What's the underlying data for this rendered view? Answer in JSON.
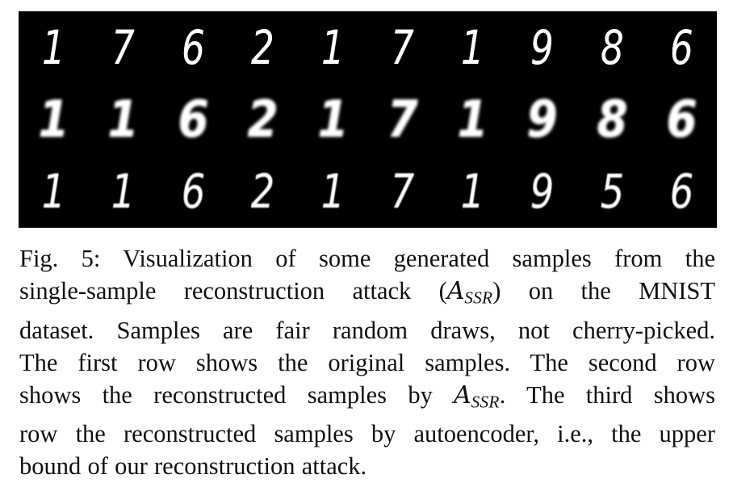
{
  "figure": {
    "label": "Fig. 5:",
    "panel": {
      "background_color": "#000000",
      "digit_color": "#ffffff",
      "columns": 10,
      "rows": 3,
      "row_descriptions": [
        "original samples",
        "reconstructed samples by A_SSR",
        "reconstructed samples by autoencoder"
      ],
      "grid": [
        [
          "1",
          "7",
          "6",
          "2",
          "1",
          "7",
          "1",
          "9",
          "8",
          "6"
        ],
        [
          "1",
          "1",
          "6",
          "2",
          "1",
          "7",
          "1",
          "9",
          "8",
          "6"
        ],
        [
          "1",
          "1",
          "6",
          "2",
          "1",
          "7",
          "1",
          "9",
          "5",
          "6"
        ]
      ]
    },
    "caption": {
      "full_text": "Fig. 5: Visualization of some generated samples from the single-sample reconstruction attack (A_SSR) on the MNIST dataset. Samples are fair random draws, not cherry-picked. The first row shows the original samples. The second row shows the reconstructed samples by A_SSR. The third shows row the reconstructed samples by autoencoder, i.e., the upper bound of our reconstruction attack.",
      "lines": [
        {
          "id": "line1",
          "segments": [
            {
              "type": "text",
              "value": "Fig. 5: Visualization of some generated samples from the"
            }
          ]
        },
        {
          "id": "line2",
          "segments": [
            {
              "type": "text",
              "value": "single-sample reconstruction attack ("
            },
            {
              "type": "mathcal",
              "value": "A"
            },
            {
              "type": "mathsub",
              "value": "SSR"
            },
            {
              "type": "text",
              "value": ") on the MNIST"
            }
          ]
        },
        {
          "id": "line3",
          "segments": [
            {
              "type": "text",
              "value": "dataset. Samples are fair random draws, not cherry-picked."
            }
          ]
        },
        {
          "id": "line4",
          "segments": [
            {
              "type": "text",
              "value": "The first row shows the original samples. The second row"
            }
          ]
        },
        {
          "id": "line5",
          "segments": [
            {
              "type": "text",
              "value": "shows the reconstructed samples by "
            },
            {
              "type": "mathcal",
              "value": "A"
            },
            {
              "type": "mathsub",
              "value": "SSR"
            },
            {
              "type": "text",
              "value": ". The third shows"
            }
          ]
        },
        {
          "id": "line6",
          "segments": [
            {
              "type": "text",
              "value": "row the reconstructed samples by autoencoder, i.e., the upper"
            }
          ]
        },
        {
          "id": "line7",
          "segments": [
            {
              "type": "text",
              "value": "bound of our reconstruction attack."
            }
          ]
        }
      ],
      "line_texts": {
        "line1": "Fig. 5: Visualization of some generated samples from the",
        "line2_prefix": "single-sample reconstruction attack (",
        "line2_math_symbol": "A",
        "line2_math_sub": "SSR",
        "line2_suffix": ") on the MNIST",
        "line3": "dataset. Samples are fair random draws, not cherry-picked.",
        "line4": "The first row shows the original samples. The second row",
        "line5_prefix": "shows the reconstructed samples by ",
        "line5_math_symbol": "A",
        "line5_math_sub": "SSR",
        "line5_suffix": ". The third shows",
        "line6": "row the reconstructed samples by autoencoder, i.e., the upper",
        "line7": "bound of our reconstruction attack."
      }
    }
  }
}
